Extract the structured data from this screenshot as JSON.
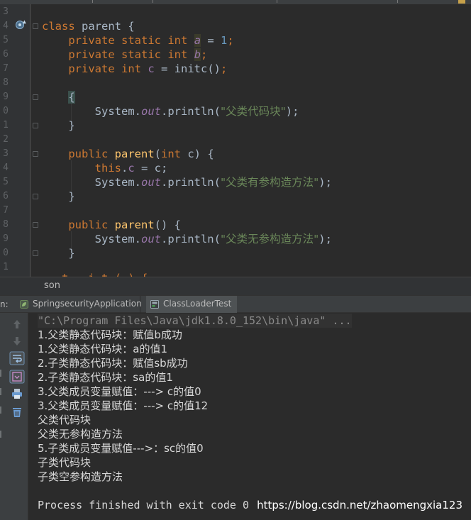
{
  "editor": {
    "line_numbers": [
      "3",
      "4",
      "5",
      "6",
      "7",
      "8",
      "9",
      "0",
      "1",
      "2",
      "3",
      "4",
      "5",
      "6",
      "7",
      "8",
      "9",
      "0",
      "1"
    ],
    "code": {
      "class_kw": "class",
      "class_name": "parent",
      "open_brace": "{",
      "close_brace": "}",
      "private": "private",
      "public": "public",
      "static": "static",
      "int": "int",
      "this": "this",
      "field_a": "a",
      "field_b": "b",
      "field_c": "c",
      "eq": " = ",
      "one": "1",
      "semi": ";",
      "initc_call": "initc()",
      "system": "System.",
      "out": "out",
      "println_open": ".println(",
      "println_close": ");",
      "str_block": "\"父类代码块\"",
      "str_param_ctor": "\"父类有参构造方法\"",
      "str_noparam_ctor": "\"父类无参构造方法\"",
      "ctor_name": "parent",
      "param_list_open": "(",
      "param_c": " c) {",
      "empty_params": "() {",
      "assign_c": " = c;",
      "dot": ".",
      "partial_cut_line": "   t   i t ( ) {"
    }
  },
  "breadcrumb": {
    "label": "son"
  },
  "run_panel": {
    "label": "n:",
    "tabs": [
      {
        "label": "SpringsecurityApplication",
        "icon": "spring-leaf-icon"
      },
      {
        "label": "ClassLoaderTest",
        "icon": "run-config-icon"
      }
    ],
    "toolbar": [
      {
        "icon": "arrow-up-icon"
      },
      {
        "icon": "arrow-down-icon"
      },
      {
        "icon": "soft-wrap-icon"
      },
      {
        "icon": "scroll-to-end-icon"
      },
      {
        "icon": "print-icon"
      },
      {
        "icon": "trash-icon"
      }
    ],
    "console_lines": [
      "\"C:\\Program Files\\Java\\jdk1.8.0_152\\bin\\java\" ...",
      "1.父类静态代码块：赋值b成功",
      "1.父类静态代码块：a的值1",
      "2.子类静态代码块：赋值sb成功",
      "2.子类静态代码块：sa的值1",
      "3.父类成员变量赋值：---> c的值0",
      "3.父类成员变量赋值：---> c的值12",
      "父类代码块",
      "父类无参构造方法",
      "5.子类成员变量赋值--->：sc的值0",
      "子类代码块",
      "子类空参构造方法",
      "",
      "Process finished with exit code 0"
    ],
    "watermark": "https://blog.csdn.net/zhaomengxia123"
  },
  "colors": {
    "keyword": "#cc7832",
    "number": "#6897bb",
    "string": "#6a8759",
    "field": "#9876aa",
    "method": "#ffc66d",
    "text": "#a9b7c6",
    "background": "#2b2b2b"
  }
}
